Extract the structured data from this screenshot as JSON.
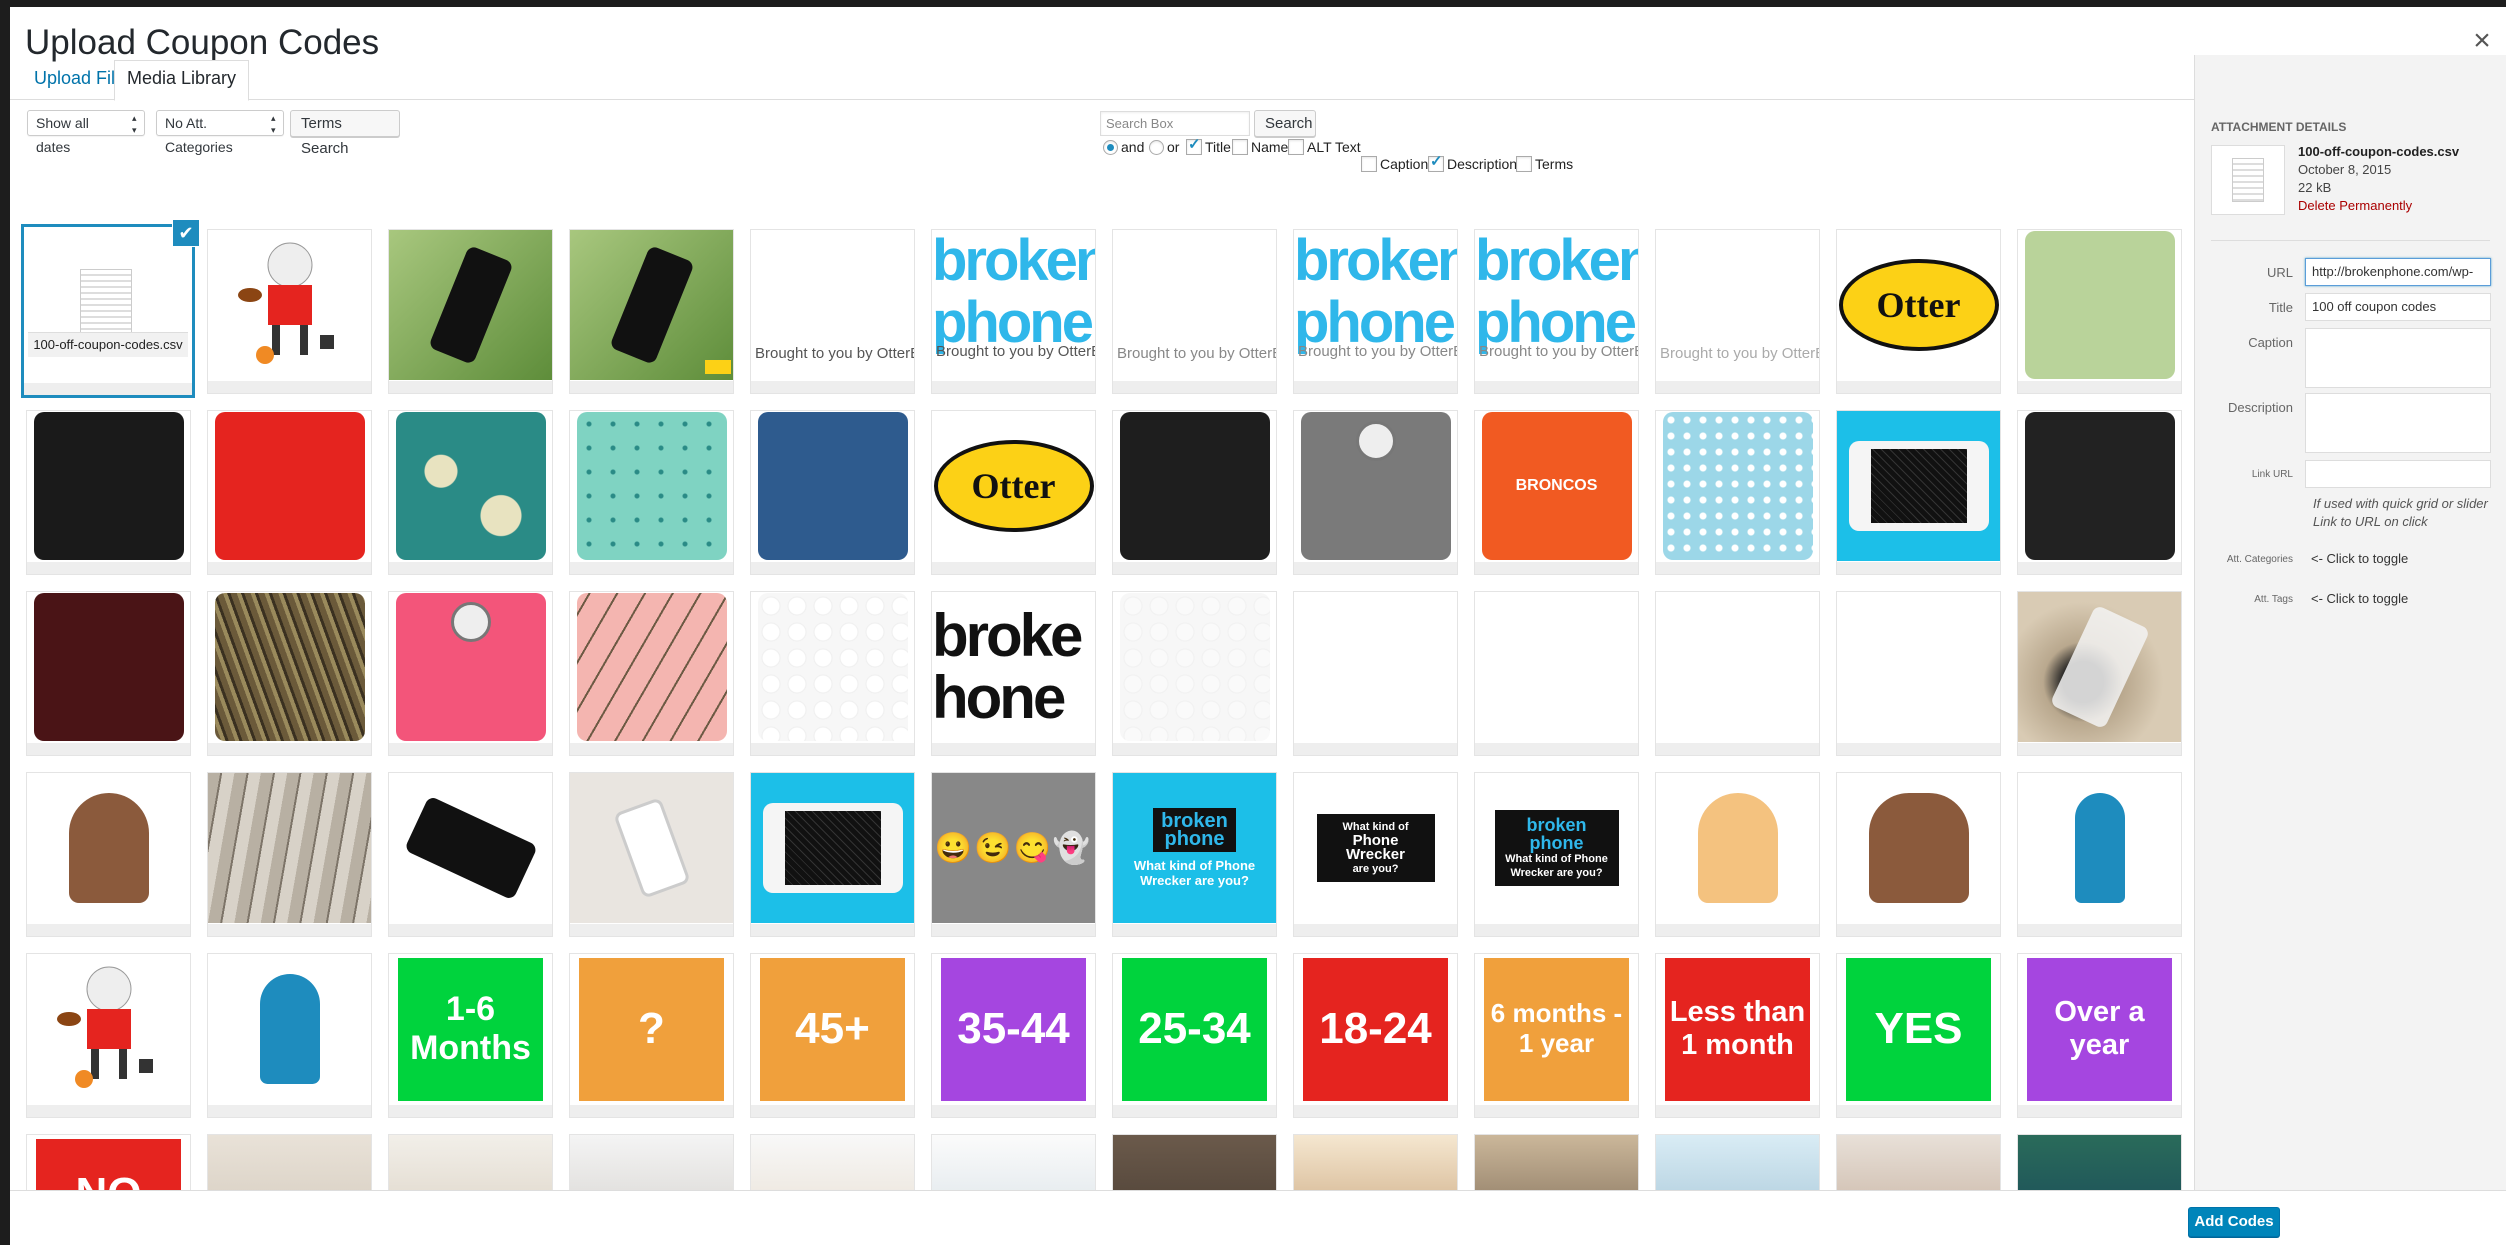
{
  "modal": {
    "title": "Upload Coupon Codes",
    "close_glyph": "×"
  },
  "tabs": [
    {
      "label": "Upload Files"
    },
    {
      "label": "Media Library"
    }
  ],
  "toolbar": {
    "dates_select": "Show all dates",
    "categories_select": "No Att. Categories",
    "terms_search_button": "Terms Search",
    "search_placeholder": "Search Box",
    "search_button": "Search",
    "options": {
      "and": {
        "label": "and",
        "checked": true
      },
      "or": {
        "label": "or",
        "checked": false
      },
      "title": {
        "label": "Title",
        "checked": true
      },
      "name": {
        "label": "Name",
        "checked": false
      },
      "alt_text": {
        "label": "ALT Text",
        "checked": false
      },
      "caption": {
        "label": "Caption",
        "checked": false
      },
      "description": {
        "label": "Description",
        "checked": true
      },
      "terms": {
        "label": "Terms",
        "checked": false
      }
    }
  },
  "grid": {
    "selected_file": {
      "name": "100-off-coupon-codes.csv",
      "check_glyph": "✔"
    },
    "texts": {
      "broken": "broken",
      "phone": "phone",
      "broke": "broke",
      "hone": "hone",
      "brought_by_otter": "Brought to you by OtterBox",
      "otter": "Otter",
      "broncos": "BRONCOS",
      "what_kind_wrecker": "What kind of Phone Wrecker are you?",
      "what_kind_of": "What kind of",
      "phone_wrecker": "Phone Wrecker",
      "are_you": "are you?",
      "emojis": "😀😉😋👻",
      "age_1_6": "1-6 Months",
      "question": "?",
      "age_45": "45+",
      "age_35": "35-44",
      "age_25": "25-34",
      "age_18": "18-24",
      "six_months": "6 months - 1 year",
      "less_month": "Less than 1 month",
      "yes": "YES",
      "over_year": "Over a year",
      "no": "NO"
    },
    "colors": {
      "green": "#00d33d",
      "orange": "#f0a03c",
      "purple": "#a546e0",
      "red": "#e5241f",
      "cyan": "#1cbfe8",
      "otter_yellow": "#fcd116",
      "broken_blue": "#2fb7ea"
    }
  },
  "sidebar": {
    "heading": "ATTACHMENT DETAILS",
    "file_name": "100-off-coupon-codes.csv",
    "date": "October 8, 2015",
    "size": "22 kB",
    "delete": "Delete Permanently",
    "url_label": "URL",
    "url_value": "http://brokenphone.com/wp-",
    "title_label": "Title",
    "title_value": "100 off coupon codes",
    "caption_label": "Caption",
    "description_label": "Description",
    "link_url_label": "Link URL",
    "link_note": "If used with quick grid or slider Link to URL on click",
    "att_categories_label": "Att. Categories",
    "att_tags_label": "Att. Tags",
    "toggle_text": "<- Click to toggle"
  },
  "footer": {
    "add_codes": "Add Codes"
  }
}
